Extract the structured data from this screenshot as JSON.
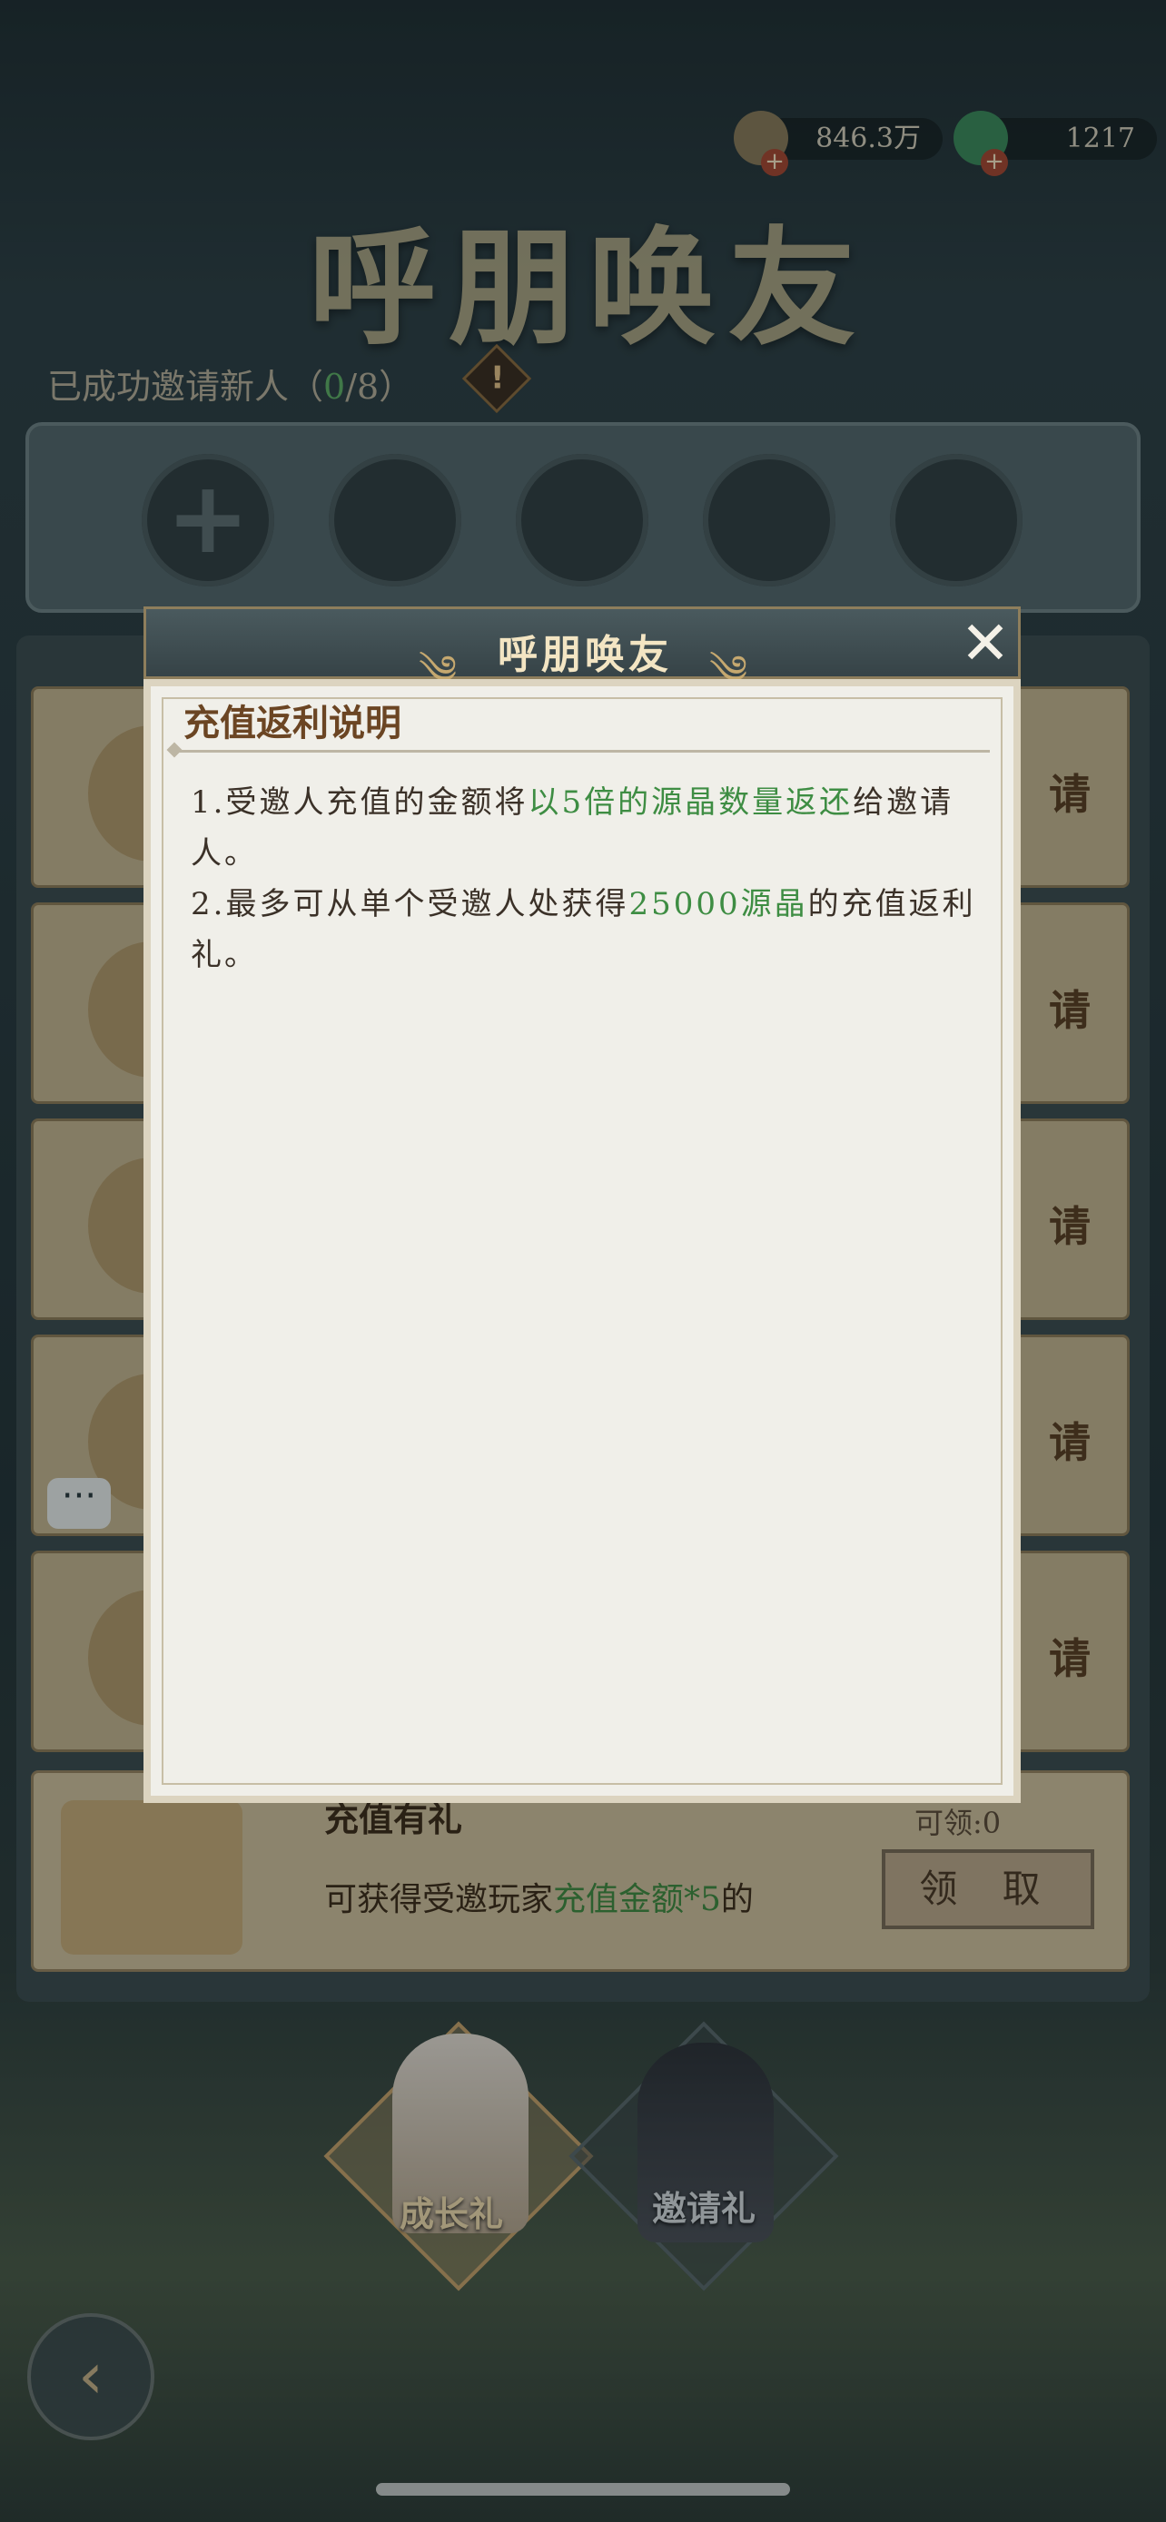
{
  "currency": {
    "coins": "846.3万",
    "gems": "1217"
  },
  "header": {
    "title_art": "呼朋唤友",
    "invite_prefix": "已成功邀请新人（",
    "invite_done": "0",
    "invite_total": "/8）",
    "warn_icon": "!"
  },
  "slots": {
    "add_icon": "+"
  },
  "rows": {
    "tail_label": "请"
  },
  "last_row": {
    "title": "充值有礼",
    "can_claim": "可领:0",
    "desc_prefix": "可获得受邀玩家",
    "desc_highlight": "充值金额*5",
    "desc_suffix": "的",
    "claim_button": "领 取"
  },
  "tabs": [
    {
      "label": "成长礼"
    },
    {
      "label": "邀请礼"
    }
  ],
  "dialog": {
    "title": "呼朋唤友",
    "subtitle": "充值返利说明",
    "line1_prefix": "1.受邀人充值的金额将",
    "line1_highlight": "以5倍的源晶数量返还",
    "line1_suffix": "给邀请人。",
    "line2_prefix": "2.最多可从单个受邀人处获得",
    "line2_highlight": "25000源晶",
    "line2_suffix": "的充值返利礼。"
  },
  "colors": {
    "highlight_green": "#3e8d43",
    "accent_gold": "#c9a36a"
  }
}
